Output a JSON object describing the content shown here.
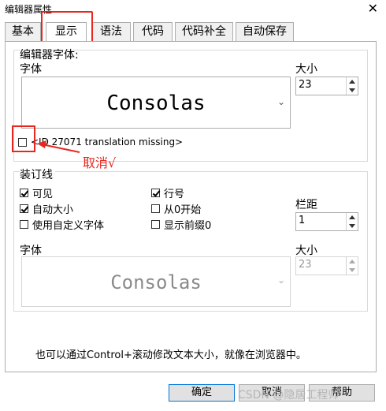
{
  "window": {
    "title": "编辑器属性",
    "close_symbol": "✕"
  },
  "tabs": [
    {
      "label": "基本"
    },
    {
      "label": "显示"
    },
    {
      "label": "语法"
    },
    {
      "label": "代码"
    },
    {
      "label": "代码补全"
    },
    {
      "label": "自动保存"
    }
  ],
  "editor_font": {
    "group_label": "编辑器字体:",
    "font_label": "字体",
    "font_name": "Consolas",
    "size_label": "大小",
    "size_value": "23",
    "checkbox_label": "<ID 27071 translation missing>",
    "checkbox_checked": false
  },
  "annotation": {
    "text": "取消√",
    "color": "#e8281f"
  },
  "gutter": {
    "group_label": "装订线",
    "options": [
      {
        "label": "可见",
        "checked": true
      },
      {
        "label": "行号",
        "checked": true
      },
      {
        "label": "自动大小",
        "checked": true
      },
      {
        "label": "从0开始",
        "checked": false
      },
      {
        "label": "使用自定义字体",
        "checked": false
      },
      {
        "label": "显示前缀0",
        "checked": false
      }
    ],
    "spacing_label": "栏距",
    "spacing_value": "1",
    "font_label": "字体",
    "font_name": "Consolas",
    "size_label": "大小",
    "size_value": "23"
  },
  "hint": "也可以通过Control+滚动修改文本大小，就像在浏览器中。",
  "buttons": {
    "ok": "确定",
    "cancel": "取消",
    "help": "帮助"
  },
  "watermark": "CSDN @隐居工程师"
}
